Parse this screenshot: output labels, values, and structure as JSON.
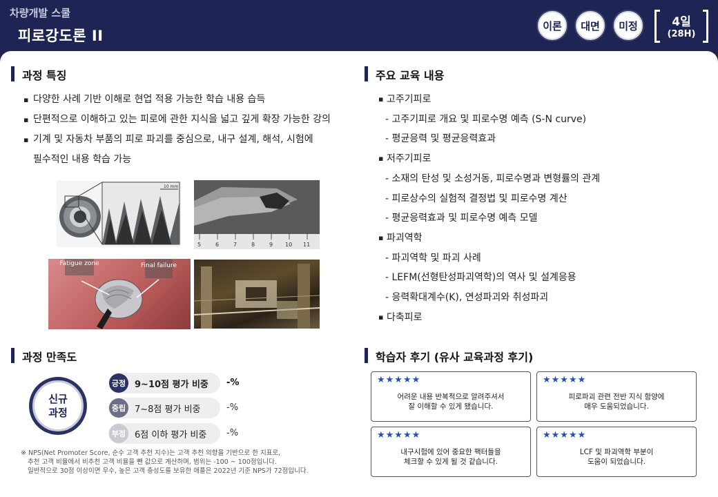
{
  "header": {
    "subtitle": "차량개발 스쿨",
    "title": "피로강도론 II",
    "badges": [
      "이론",
      "대면",
      "미정"
    ],
    "duration_days": "4일",
    "duration_hours": "(28H)"
  },
  "features": {
    "title": "과정 특징",
    "items": [
      "다양한 사례 기반 이해로 현업 적용 가능한 학습 내용 습득",
      "단편적으로 이해하고 있는 피로에 관한 지식을 넓고 깊게 확장 가능한 강의",
      "기계 및 자동차 부품의 피로 파괴를 중심으로, 내구 설계, 해석, 시험에",
      "필수적인 내용 학습 가능"
    ],
    "photo_labels": {
      "scale": "10 mm",
      "ruler": [
        "5",
        "6",
        "7",
        "8",
        "9",
        "10",
        "11"
      ],
      "fatigue_zone": "Fatigue zone",
      "final_failure": "Final failure"
    }
  },
  "education": {
    "title": "주요 교육 내용",
    "items": [
      {
        "level": 1,
        "text": "고주기피로"
      },
      {
        "level": 2,
        "text": "- 고주기피로 개요 및 피로수명 예측 (S-N curve)"
      },
      {
        "level": 2,
        "text": "- 평균응력 및 평균응력효과"
      },
      {
        "level": 1,
        "text": "저주기피로"
      },
      {
        "level": 2,
        "text": "- 소재의 탄성 및 소성거동, 피로수명과 변형률의 관계"
      },
      {
        "level": 2,
        "text": "- 피로상수의 실험적 결정법 및 피로수명 계산"
      },
      {
        "level": 2,
        "text": "- 평균응력효과 및 피로수명 예측 모델"
      },
      {
        "level": 1,
        "text": "파괴역학"
      },
      {
        "level": 2,
        "text": "- 파괴역학 및 파괴 사례"
      },
      {
        "level": 2,
        "text": "- LEFM(선형탄성파괴역학)의 역사 및 설계응용"
      },
      {
        "level": 2,
        "text": "- 응력확대계수(K), 연성파괴와 취성파괴"
      },
      {
        "level": 1,
        "text": "다축피로"
      }
    ]
  },
  "satisfaction": {
    "title": "과정 만족도",
    "circle_line1": "신규",
    "circle_line2": "과정",
    "rows": [
      {
        "tag": "긍정",
        "label": "9~10점 평가 비중",
        "value": "-%",
        "color": "#2a3163"
      },
      {
        "tag": "중립",
        "label": "7~8점 평가 비중",
        "value": "-%",
        "color": "#6b6f85"
      },
      {
        "tag": "부정",
        "label": "6점 이하 평가 비중",
        "value": "-%",
        "color": "#c9cad2"
      }
    ],
    "footnote": [
      "※ NPS(Net Promoter Score, 순수 고객 추천 지수)는 고객 추천 의향을 기반으로 한 지표로,",
      "추천 고객 비율에서 비추천 고객 비율을 뺀 값으로 계산하며, 범위는 -100 ~ 100점입니다.",
      "일반적으로 30점 이상이면 우수, 높은 고객 충성도를 보유한 애플은 2022년 기준 NPS가 72점입니다."
    ]
  },
  "reviews": {
    "title": "학습자 후기 (유사 교육과정 후기)",
    "stars": "★★★★★",
    "items": [
      {
        "line1": "어려운 내용 반복적으로 알려주셔서",
        "line2": "잘 이해할 수 있게 됐습니다."
      },
      {
        "line1": "피로파괴 관련 전반 지식 함양에",
        "line2": "매우 도움되었습니다."
      },
      {
        "line1": "내구시험에 있어 중요한 팩터들을",
        "line2": "체크할 수 있게 될 것 같습니다."
      },
      {
        "line1": "LCF 및 파괴역학 부분이",
        "line2": "도움이 되었습니다."
      }
    ]
  }
}
